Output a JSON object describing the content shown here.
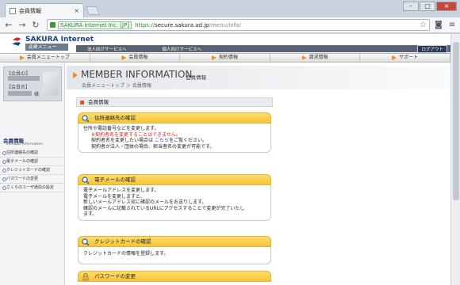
{
  "browser": {
    "tab_title": "会員情報",
    "url_ev": "SAKURA Internet Inc. [JP]",
    "url_scheme": "https://",
    "url_host": "secure.sakura.ad.jp",
    "url_path": "/menu/info/"
  },
  "site": {
    "logo_text": "SAKURA Internet",
    "logo_sub": "会員メニュー",
    "topbar": [
      "法人向けサービスへ",
      "個人向けサービスへ"
    ],
    "logout": "ログアウト"
  },
  "nav": [
    "会員メニュートップ",
    "会員情報",
    "契約情報",
    "請求情報",
    "サポート"
  ],
  "sidebar": {
    "member_id_label": "【会員ID】",
    "member_name_label": "【会員名】",
    "sama": "様",
    "section_title": "会員情報",
    "section_sub": "Member information",
    "items": [
      "住所連絡先の確認",
      "電子メールの確認",
      "クレジットカードの確認",
      "パスワードの変更",
      "さくらのユーザ通信の設定"
    ]
  },
  "main": {
    "title_en": "MEMBER INFORMATION",
    "title_jp": "会員情報",
    "breadcrumb": "会員メニュートップ ＞ 会員情報",
    "section_head": "会員情報",
    "cards": [
      {
        "title": "住所連絡先の確認",
        "lines": [
          "住所や電話番号などを変更します。"
        ],
        "red": "※契約者名を変更することはできません。",
        "sub1": "契約者名を変更したい場合は ",
        "link": "こちら",
        "sub1b": "をご覧ください。",
        "sub2": "契約者が法人・団体の場合、担当者名の変更が可能です。"
      },
      {
        "title": "電子メールの確認",
        "lines": [
          "電子メールアドレスを変更します。",
          "電子メールを変更しますと、",
          "新しいメールアドレス宛に確認のメールをお送りします。",
          "確認のメールに記載されているURLにアクセスすることで変更が完了いたし",
          "ます。"
        ]
      },
      {
        "title": "クレジットカードの確認",
        "lines": [
          "クレジットカードの情報を登録します。"
        ]
      },
      {
        "title": "パスワードの変更",
        "lines": []
      }
    ]
  },
  "colors": {
    "accent": "#f18c1a",
    "card_head": "#f6c43c",
    "brand": "#1a3f8f"
  }
}
